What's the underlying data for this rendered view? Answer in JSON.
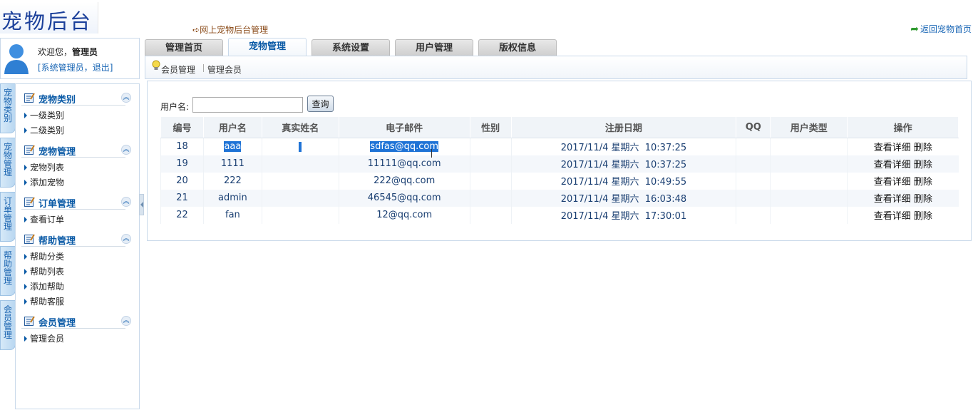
{
  "header": {
    "logo_text": "宠物后台",
    "breadcrumb": "网上宠物后台管理",
    "back_link": "返回宠物首页"
  },
  "user": {
    "welcome": "欢迎您，",
    "name": "管理员",
    "role_link": "[系统管理员，",
    "logout_link": "退出]"
  },
  "tabs": [
    {
      "label": "管理首页",
      "active": false
    },
    {
      "label": "宠物管理",
      "active": true
    },
    {
      "label": "系统设置",
      "active": false
    },
    {
      "label": "用户管理",
      "active": false
    },
    {
      "label": "版权信息",
      "active": false
    }
  ],
  "subnav": [
    "会员管理",
    "管理会员"
  ],
  "vtabs": [
    "宠物类别",
    "宠物管理",
    "订单管理",
    "帮助管理",
    "会员管理"
  ],
  "sidebar": [
    {
      "title": "宠物类别",
      "items": [
        "一级类别",
        "二级类别"
      ]
    },
    {
      "title": "宠物管理",
      "items": [
        "宠物列表",
        "添加宠物"
      ]
    },
    {
      "title": "订单管理",
      "items": [
        "查看订单"
      ]
    },
    {
      "title": "帮助管理",
      "items": [
        "帮助分类",
        "帮助列表",
        "添加帮助",
        "帮助客服"
      ]
    },
    {
      "title": "会员管理",
      "items": [
        "管理会员"
      ]
    }
  ],
  "search": {
    "label": "用户名:",
    "value": "",
    "button": "查询"
  },
  "table": {
    "headers": [
      "编号",
      "用户名",
      "真实姓名",
      "电子邮件",
      "性别",
      "注册日期",
      "QQ",
      "用户类型",
      "操作"
    ],
    "ops": [
      "查看详细",
      "删除"
    ],
    "rows": [
      {
        "id": "18",
        "username": "aaa",
        "realname": "",
        "email": "sdfas@qq.com",
        "gender": "",
        "date": "2017/11/4 星期六  10:37:25",
        "qq": "",
        "type": ""
      },
      {
        "id": "19",
        "username": "1111",
        "realname": "",
        "email": "11111@qq.com",
        "gender": "",
        "date": "2017/11/4 星期六  10:37:25",
        "qq": "",
        "type": ""
      },
      {
        "id": "20",
        "username": "222",
        "realname": "",
        "email": "222@qq.com",
        "gender": "",
        "date": "2017/11/4 星期六  10:49:55",
        "qq": "",
        "type": ""
      },
      {
        "id": "21",
        "username": "admin",
        "realname": "",
        "email": "46545@qq.com",
        "gender": "",
        "date": "2017/11/4 星期六  16:03:48",
        "qq": "",
        "type": ""
      },
      {
        "id": "22",
        "username": "fan",
        "realname": "",
        "email": "12@qq.com",
        "gender": "",
        "date": "2017/11/4 星期六  17:30:01",
        "qq": "",
        "type": ""
      }
    ]
  }
}
